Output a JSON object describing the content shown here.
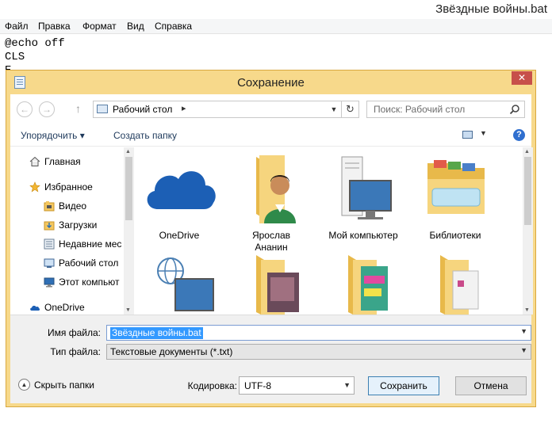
{
  "notepad": {
    "title": "Звёздные войны.bat",
    "menu": [
      "Файл",
      "Правка",
      "Формат",
      "Вид",
      "Справка"
    ],
    "lines": [
      "@echo off",
      "CLS",
      "Ε"
    ]
  },
  "dialog": {
    "title": "Сохранение",
    "close_symbol": "✕",
    "address": {
      "location": "Рабочий стол",
      "separator": "▸"
    },
    "search": {
      "placeholder": "Поиск: Рабочий стол"
    },
    "toolbar": {
      "organize_label": "Упорядочить ▾",
      "new_folder_label": "Создать папку",
      "help": "?"
    },
    "nav_items": [
      {
        "label": "Главная",
        "icon": "home-icon"
      },
      {
        "label": "Избранное",
        "icon": "star-icon"
      },
      {
        "label": "Видео",
        "icon": "video-folder-icon"
      },
      {
        "label": "Загрузки",
        "icon": "downloads-folder-icon"
      },
      {
        "label": "Недавние мес",
        "icon": "recent-places-icon"
      },
      {
        "label": "Рабочий стол",
        "icon": "desktop-icon"
      },
      {
        "label": "Этот компьют",
        "icon": "computer-icon"
      },
      {
        "label": "OneDrive",
        "icon": "onedrive-icon"
      }
    ],
    "files": [
      {
        "label": "OneDrive",
        "icon": "onedrive-cloud-icon"
      },
      {
        "label": "Ярослав\nАнанин",
        "icon": "user-folder-icon"
      },
      {
        "label": "Мой компьютер",
        "icon": "my-computer-icon"
      },
      {
        "label": "Библиотеки",
        "icon": "libraries-icon"
      },
      {
        "label": "",
        "icon": "network-icon"
      },
      {
        "label": "",
        "icon": "photo-folder-icon"
      },
      {
        "label": "",
        "icon": "colorful-folder-icon"
      },
      {
        "label": "",
        "icon": "documents-folder-icon"
      }
    ],
    "form": {
      "filename_label": "Имя файла:",
      "filename_value": "Звёздные войны.bat",
      "filetype_label": "Тип файла:",
      "filetype_value": "Текстовые документы (*.txt)",
      "hide_folders_label": "Скрыть папки",
      "encoding_label": "Кодировка:",
      "encoding_value": "UTF-8",
      "save_label": "Сохранить",
      "cancel_label": "Отмена"
    }
  },
  "colors": {
    "dialog_frame": "#f7d98b",
    "selection": "#3399ff",
    "close_button": "#c7504a",
    "folder": "#f4c75f",
    "onedrive_blue": "#1c5fb5"
  }
}
